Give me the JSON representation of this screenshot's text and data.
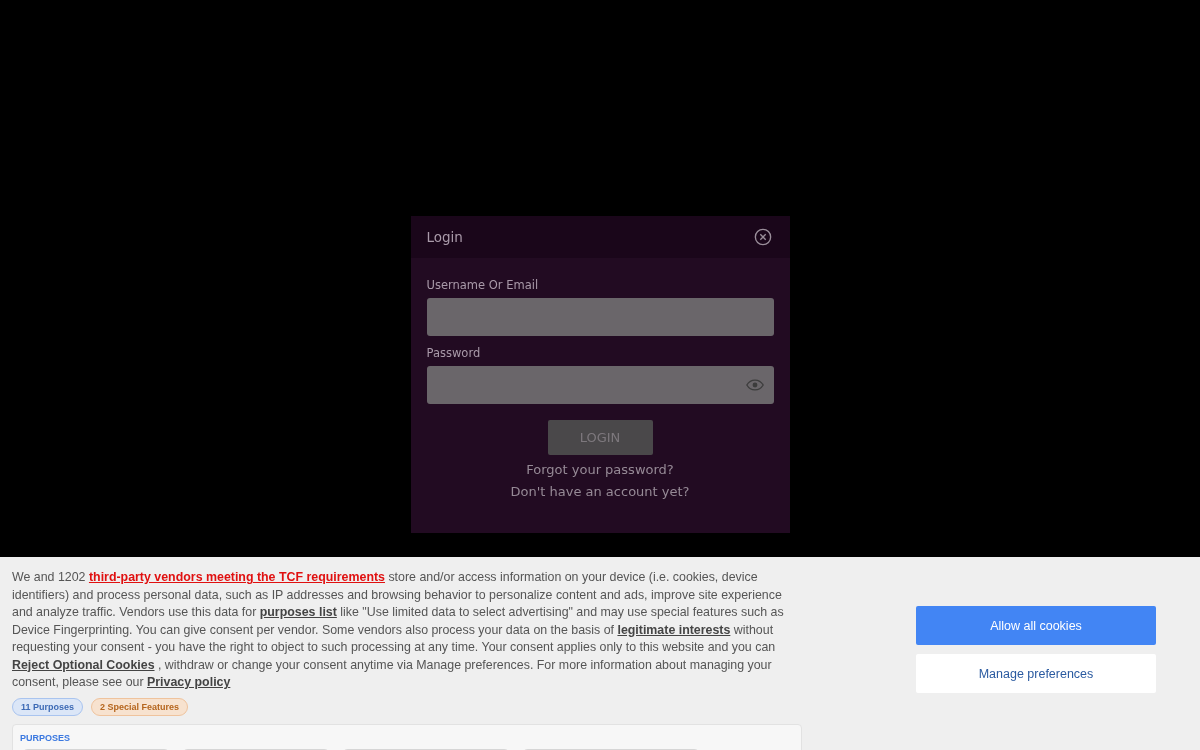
{
  "login_dialog": {
    "title": "Login",
    "fields": [
      {
        "kind": "text",
        "label": "Username Or Email"
      },
      {
        "kind": "password",
        "label": "Password"
      }
    ],
    "button": "LOGIN",
    "links": [
      "Forgot your password?",
      "Don't have an account yet?"
    ]
  },
  "consent_banner": {
    "paragraph": [
      {
        "kind": "text",
        "text": "We and 1202 "
      },
      {
        "kind": "vendor-link",
        "text": "third-party vendors meeting the TCF requirements"
      },
      {
        "kind": "text",
        "text": " store and/or access information on your device (i.e. cookies, device identifiers) and process personal data, such as IP addresses and browsing behavior to personalize content and ads, improve site experience and analyze traffic. Vendors use this data for "
      },
      {
        "kind": "link",
        "text": "purposes list"
      },
      {
        "kind": "text",
        "text": "  like \"Use limited data to select advertising\" and may use special features such as Device Fingerprinting. You can give consent per vendor. Some vendors also process your data on the basis of "
      },
      {
        "kind": "link",
        "text": "legitimate interests"
      },
      {
        "kind": "text",
        "text": "  without requesting your consent - you have the right to object to such processing at any time. Your consent applies only to this website and you can "
      },
      {
        "kind": "link",
        "text": "Reject Optional Cookies"
      },
      {
        "kind": "text",
        "text": " , withdraw or change your consent anytime via Manage preferences. For more information about managing your consent, please see our "
      },
      {
        "kind": "link",
        "text": "Privacy policy"
      }
    ],
    "badges": [
      {
        "kind": "purposes",
        "text": "11 Purposes"
      },
      {
        "kind": "features",
        "text": "2 Special Features"
      }
    ],
    "purposes_heading": "PURPOSES",
    "buttons": [
      {
        "kind": "primary",
        "text": "Allow all cookies"
      },
      {
        "kind": "secondary",
        "text": "Manage preferences"
      }
    ]
  }
}
